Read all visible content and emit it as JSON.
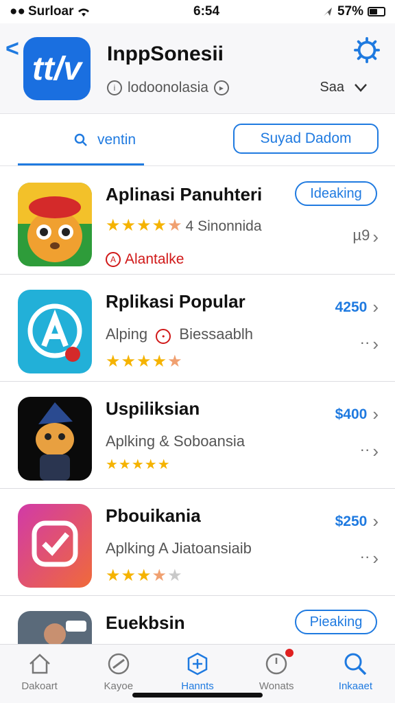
{
  "status": {
    "carrier": "Surloar",
    "time": "6:54",
    "battery": "57%",
    "battery_level": 0.57
  },
  "header": {
    "back": "<",
    "icon_text": "tt/v",
    "title": "InppSonesii",
    "subtitle": "lodoonolasia",
    "sort_label": "Saa",
    "sort_icon": "chevron-down-icon"
  },
  "tabs": {
    "search_label": "ventin",
    "button_label": "Suyad Dadom"
  },
  "apps": [
    {
      "name": "Aplinasi Panuhteri",
      "rating_text": "4 Sinonnida",
      "stars": 4.5,
      "tag": "Alantalke",
      "action": "Ideaking",
      "more": "µ9",
      "color": "#f5b301"
    },
    {
      "name": "Rplikasi Popular",
      "subtitle": "Alping",
      "subtitle2": "Biessaablh",
      "stars": 4.5,
      "price": "4250",
      "more": "··"
    },
    {
      "name": "Uspiliksian",
      "subtitle": "Aplking & Soboansia",
      "stars": 5,
      "price": "$400",
      "more": "··"
    },
    {
      "name": "Pbouikania",
      "subtitle": "Aplking A Jiatoansiaib",
      "stars": 3.5,
      "price": "$250",
      "more": "··"
    },
    {
      "name": "Euekbsin",
      "action": "Pieaking"
    }
  ],
  "tabbar": [
    {
      "label": "Dakoart",
      "icon": "house-icon"
    },
    {
      "label": "Kayoe",
      "icon": "badge-icon"
    },
    {
      "label": "Hannts",
      "icon": "plus-icon"
    },
    {
      "label": "Wonats",
      "icon": "clock-icon"
    },
    {
      "label": "Inkaaet",
      "icon": "search-icon"
    }
  ]
}
